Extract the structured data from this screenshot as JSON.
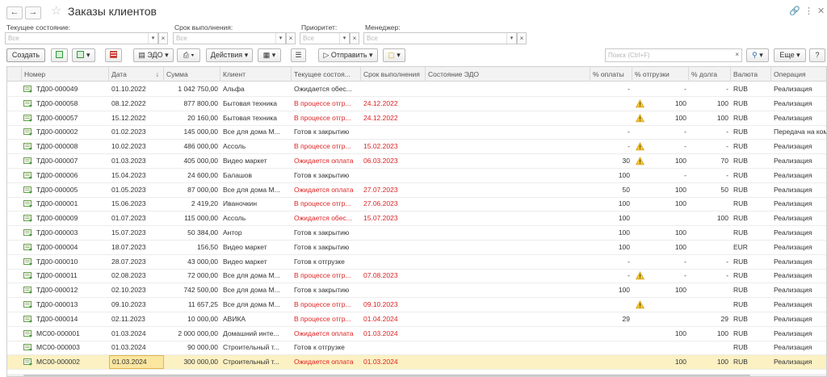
{
  "header": {
    "title": "Заказы клиентов",
    "back_icon": "arrow-left",
    "forward_icon": "arrow-right",
    "link_icon": "link",
    "more_icon": "more-vertical",
    "close_icon": "close"
  },
  "filters": {
    "state": {
      "label": "Текущее состояние:",
      "placeholder": "Все"
    },
    "deadline": {
      "label": "Срок выполнения:",
      "placeholder": "Все"
    },
    "priority": {
      "label": "Приоритет:",
      "placeholder": "Все"
    },
    "manager": {
      "label": "Менеджер:",
      "placeholder": "Все"
    }
  },
  "toolbar": {
    "create": "Создать",
    "edo": "ЭДО",
    "actions": "Действия",
    "send": "Отправить",
    "search_placeholder": "Поиск (Ctrl+F)",
    "more": "Еще"
  },
  "table": {
    "columns": [
      "Номер",
      "Дата",
      "Сумма",
      "Клиент",
      "Текущее состоя...",
      "Срок выполнения",
      "Состояние ЭДО",
      "% оплаты",
      "% отгрузки",
      "% долга",
      "Валюта",
      "Операция"
    ],
    "sort_indicator": "↓",
    "rows": [
      {
        "num": "ТД00-000049",
        "date": "01.10.2022",
        "sum": "1 042 750,00",
        "client": "Альфа",
        "state": "Ожидается обес...",
        "state_red": false,
        "deadline": "",
        "pay": "-",
        "ship": "-",
        "warn": false,
        "debt": "-",
        "cur": "RUB",
        "op": "Реализация"
      },
      {
        "num": "ТД00-000058",
        "date": "08.12.2022",
        "sum": "877 800,00",
        "client": "Бытовая техника",
        "state": "В процессе отгр...",
        "state_red": true,
        "deadline": "24.12.2022",
        "pay": "",
        "ship": "100",
        "warn": true,
        "debt": "100",
        "cur": "RUB",
        "op": "Реализация"
      },
      {
        "num": "ТД00-000057",
        "date": "15.12.2022",
        "sum": "20 160,00",
        "client": "Бытовая техника",
        "state": "В процессе отгр...",
        "state_red": true,
        "deadline": "24.12.2022",
        "pay": "",
        "ship": "100",
        "warn": true,
        "debt": "100",
        "cur": "RUB",
        "op": "Реализация"
      },
      {
        "num": "ТД00-000002",
        "date": "01.02.2023",
        "sum": "145 000,00",
        "client": "Все для дома М...",
        "state": "Готов к закрытию",
        "state_red": false,
        "deadline": "",
        "pay": "-",
        "ship": "-",
        "warn": false,
        "debt": "-",
        "cur": "RUB",
        "op": "Передача на ком"
      },
      {
        "num": "ТД00-000008",
        "date": "10.02.2023",
        "sum": "486 000,00",
        "client": "Ассоль",
        "state": "В процессе отгр...",
        "state_red": true,
        "deadline": "15.02.2023",
        "pay": "-",
        "ship": "-",
        "warn": true,
        "debt": "-",
        "cur": "RUB",
        "op": "Реализация"
      },
      {
        "num": "ТД00-000007",
        "date": "01.03.2023",
        "sum": "405 000,00",
        "client": "Видео маркет",
        "state": "Ожидается оплата",
        "state_red": true,
        "deadline": "06.03.2023",
        "pay": "30",
        "ship": "100",
        "warn": true,
        "debt": "70",
        "cur": "RUB",
        "op": "Реализация"
      },
      {
        "num": "ТД00-000006",
        "date": "15.04.2023",
        "sum": "24 600,00",
        "client": "Балашов",
        "state": "Готов к закрытию",
        "state_red": false,
        "deadline": "",
        "pay": "100",
        "ship": "-",
        "warn": false,
        "debt": "-",
        "cur": "RUB",
        "op": "Реализация"
      },
      {
        "num": "ТД00-000005",
        "date": "01.05.2023",
        "sum": "87 000,00",
        "client": "Все для дома М...",
        "state": "Ожидается оплата",
        "state_red": true,
        "deadline": "27.07.2023",
        "pay": "50",
        "ship": "100",
        "warn": false,
        "debt": "50",
        "cur": "RUB",
        "op": "Реализация"
      },
      {
        "num": "ТД00-000001",
        "date": "15.06.2023",
        "sum": "2 419,20",
        "client": "Иваночкин",
        "state": "В процессе отгр...",
        "state_red": true,
        "deadline": "27.06.2023",
        "pay": "100",
        "ship": "100",
        "warn": false,
        "debt": "",
        "cur": "RUB",
        "op": "Реализация"
      },
      {
        "num": "ТД00-000009",
        "date": "01.07.2023",
        "sum": "115 000,00",
        "client": "Ассоль",
        "state": "Ожидается обес...",
        "state_red": true,
        "deadline": "15.07.2023",
        "pay": "100",
        "ship": "",
        "warn": false,
        "debt": "100",
        "cur": "RUB",
        "op": "Реализация"
      },
      {
        "num": "ТД00-000003",
        "date": "15.07.2023",
        "sum": "50 384,00",
        "client": "Антор",
        "state": "Готов к закрытию",
        "state_red": false,
        "deadline": "",
        "pay": "100",
        "ship": "100",
        "warn": false,
        "debt": "",
        "cur": "RUB",
        "op": "Реализация"
      },
      {
        "num": "ТД00-000004",
        "date": "18.07.2023",
        "sum": "156,50",
        "client": "Видео маркет",
        "state": "Готов к закрытию",
        "state_red": false,
        "deadline": "",
        "pay": "100",
        "ship": "100",
        "warn": false,
        "debt": "",
        "cur": "EUR",
        "op": "Реализация"
      },
      {
        "num": "ТД00-000010",
        "date": "28.07.2023",
        "sum": "43 000,00",
        "client": "Видео маркет",
        "state": "Готов к отгрузке",
        "state_red": false,
        "deadline": "",
        "pay": "-",
        "ship": "-",
        "warn": false,
        "debt": "-",
        "cur": "RUB",
        "op": "Реализация"
      },
      {
        "num": "ТД00-000011",
        "date": "02.08.2023",
        "sum": "72 000,00",
        "client": "Все для дома М...",
        "state": "В процессе отгр...",
        "state_red": true,
        "deadline": "07.08.2023",
        "pay": "-",
        "ship": "-",
        "warn": true,
        "debt": "-",
        "cur": "RUB",
        "op": "Реализация"
      },
      {
        "num": "ТД00-000012",
        "date": "02.10.2023",
        "sum": "742 500,00",
        "client": "Все для дома М...",
        "state": "Готов к закрытию",
        "state_red": false,
        "deadline": "",
        "pay": "100",
        "ship": "100",
        "warn": false,
        "debt": "",
        "cur": "RUB",
        "op": "Реализация"
      },
      {
        "num": "ТД00-000013",
        "date": "09.10.2023",
        "sum": "11 657,25",
        "client": "Все для дома М...",
        "state": "В процессе отгр...",
        "state_red": true,
        "deadline": "09.10.2023",
        "pay": "",
        "ship": "",
        "warn": true,
        "debt": "",
        "cur": "RUB",
        "op": "Реализация"
      },
      {
        "num": "ТД00-000014",
        "date": "02.11.2023",
        "sum": "10 000,00",
        "client": "АВИКА",
        "state": "В процессе отгр...",
        "state_red": true,
        "deadline": "01.04.2024",
        "pay": "29",
        "ship": "",
        "warn": false,
        "debt": "29",
        "cur": "RUB",
        "op": "Реализация"
      },
      {
        "num": "МС00-000001",
        "date": "01.03.2024",
        "sum": "2 000 000,00",
        "client": "Домашний инте...",
        "state": "Ожидается оплата",
        "state_red": true,
        "deadline": "01.03.2024",
        "pay": "",
        "ship": "100",
        "warn": false,
        "debt": "100",
        "cur": "RUB",
        "op": "Реализация"
      },
      {
        "num": "МС00-000003",
        "date": "01.03.2024",
        "sum": "90 000,00",
        "client": "Строительный т...",
        "state": "Готов к отгрузке",
        "state_red": false,
        "deadline": "",
        "pay": "",
        "ship": "",
        "warn": false,
        "debt": "",
        "cur": "RUB",
        "op": "Реализация"
      },
      {
        "num": "МС00-000002",
        "date": "01.03.2024",
        "sum": "300 000,00",
        "client": "Строительный т...",
        "state": "Ожидается оплата",
        "state_red": true,
        "deadline": "01.03.2024",
        "pay": "",
        "ship": "100",
        "warn": false,
        "debt": "100",
        "cur": "RUB",
        "op": "Реализация",
        "selected": true
      }
    ]
  },
  "colors": {
    "accent": "#4c8a2a",
    "red_text": "#d22222",
    "selected_row": "#fbf1c3",
    "warning": "#f2c232"
  }
}
